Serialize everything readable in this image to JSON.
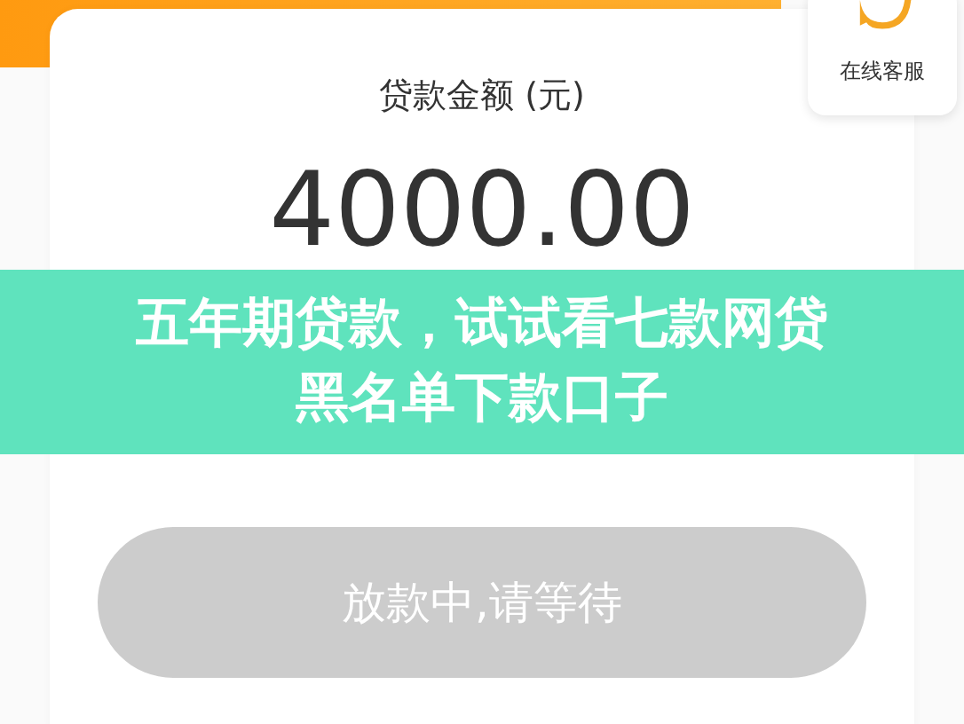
{
  "service_widget": {
    "label": "在线客服"
  },
  "loan_card": {
    "amount_label": "贷款金额 (元)",
    "amount": "4000.00",
    "button": {
      "label": "放款中,请等待",
      "disabled": true
    }
  },
  "banner": {
    "lines": [
      "五年期贷款，试试看七款网贷",
      "黑名单下款口子"
    ]
  }
}
